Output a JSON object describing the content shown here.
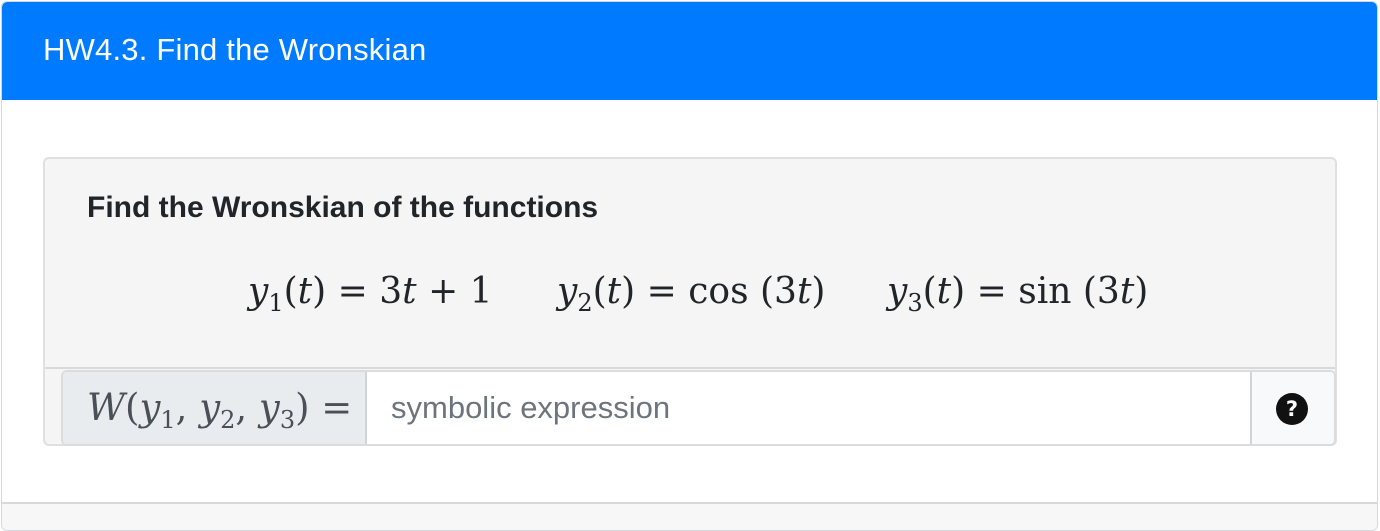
{
  "header": {
    "title": "HW4.3. Find the Wronskian",
    "background_color": "#007bff"
  },
  "question": {
    "prompt": "Find the Wronskian of the functions",
    "functions": [
      {
        "name": "y",
        "index": "1",
        "var": "t",
        "rhs_text": "3t + 1"
      },
      {
        "name": "y",
        "index": "2",
        "var": "t",
        "rhs_text": "cos (3t)"
      },
      {
        "name": "y",
        "index": "3",
        "var": "t",
        "rhs_text": "sin (3t)"
      }
    ]
  },
  "answer": {
    "label": "W(y1, y2, y3) =",
    "placeholder": "symbolic expression",
    "value": "",
    "help_icon": "question-circle-icon",
    "help_glyph": "?"
  }
}
